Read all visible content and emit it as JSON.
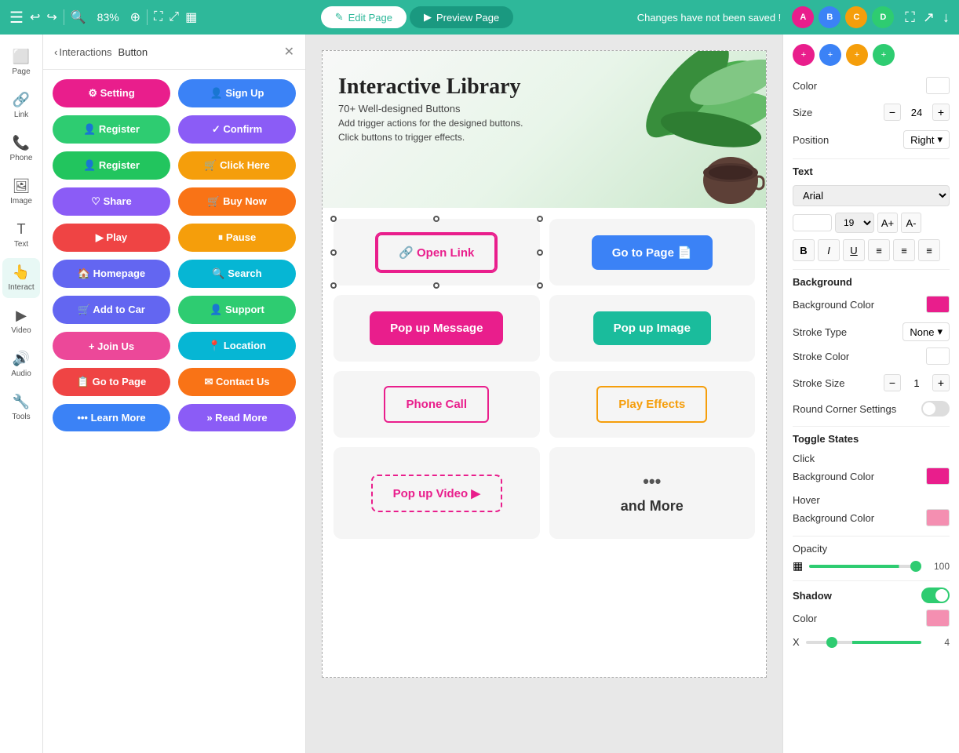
{
  "topbar": {
    "zoom": "83%",
    "edit_page_label": "Edit Page",
    "preview_page_label": "Preview Page",
    "unsaved_notice": "Changes have not been saved !"
  },
  "interactions_panel": {
    "back_label": "Interactions",
    "title": "Button",
    "buttons": [
      {
        "label": "Setting",
        "color": "pink",
        "icon": "⚙"
      },
      {
        "label": "Sign Up",
        "color": "blue",
        "icon": "👤"
      },
      {
        "label": "Register",
        "color": "teal",
        "icon": "👤"
      },
      {
        "label": "Confirm",
        "color": "purple",
        "icon": "✓"
      },
      {
        "label": "Register",
        "color": "green",
        "icon": "👤"
      },
      {
        "label": "Click Here",
        "color": "orange",
        "icon": "🛒"
      },
      {
        "label": "Share",
        "color": "purple",
        "icon": "♡"
      },
      {
        "label": "Buy Now",
        "color": "orange",
        "icon": "🛒"
      },
      {
        "label": "Play",
        "color": "red",
        "icon": "▶"
      },
      {
        "label": "Pause",
        "color": "amber",
        "icon": "⏸"
      },
      {
        "label": "Homepage",
        "color": "indigo",
        "icon": "🏠"
      },
      {
        "label": "Search",
        "color": "cyan",
        "icon": "🔍"
      },
      {
        "label": "Add to Car",
        "color": "indigo",
        "icon": "🛒"
      },
      {
        "label": "Support",
        "color": "teal",
        "icon": "👤"
      },
      {
        "label": "Join Us",
        "color": "magenta",
        "icon": "+"
      },
      {
        "label": "Location",
        "color": "cyan",
        "icon": "📍"
      },
      {
        "label": "Go to Page",
        "color": "red",
        "icon": "📋"
      },
      {
        "label": "Contact Us",
        "color": "orange",
        "icon": "✉"
      },
      {
        "label": "Learn More",
        "color": "blue",
        "icon": "•••"
      },
      {
        "label": "Read More",
        "color": "purple",
        "icon": "»"
      }
    ]
  },
  "canvas": {
    "title": "Interactive Library",
    "subtitle1": "70+ Well-designed Buttons",
    "subtitle2": "Add trigger actions for the designed buttons.",
    "subtitle3": "Click buttons to trigger effects.",
    "buttons": [
      {
        "label": "Open Link",
        "type": "pink-border",
        "icon": "🔗"
      },
      {
        "label": "Go to Page",
        "type": "blue-solid",
        "icon": "📄"
      },
      {
        "label": "Pop up Message",
        "type": "pink-solid"
      },
      {
        "label": "Pop up Image",
        "type": "teal-solid"
      },
      {
        "label": "Phone Call",
        "type": "pink-border"
      },
      {
        "label": "Play Effects",
        "type": "orange-border"
      },
      {
        "label": "Pop up Video",
        "type": "pink-ghost",
        "icon": "▶"
      },
      {
        "label": "and More",
        "type": "more-text"
      }
    ]
  },
  "right_panel": {
    "color_label": "Color",
    "size_label": "Size",
    "size_value": "24",
    "position_label": "Position",
    "position_value": "Right",
    "text_label": "Text",
    "font_value": "Arial",
    "font_size_value": "19",
    "background_label": "Background",
    "bg_color_label": "Background Color",
    "stroke_type_label": "Stroke Type",
    "stroke_type_value": "None",
    "stroke_color_label": "Stroke Color",
    "stroke_size_label": "Stroke Size",
    "stroke_size_value": "1",
    "round_corner_label": "Round Corner Settings",
    "toggle_states_label": "Toggle States",
    "click_label": "Click",
    "click_bg_label": "Background Color",
    "hover_label": "Hover",
    "hover_bg_label": "Background Color",
    "opacity_label": "Opacity",
    "opacity_value": "100",
    "shadow_label": "Shadow",
    "shadow_color_label": "Color",
    "x_label": "X",
    "x_value": "4"
  }
}
